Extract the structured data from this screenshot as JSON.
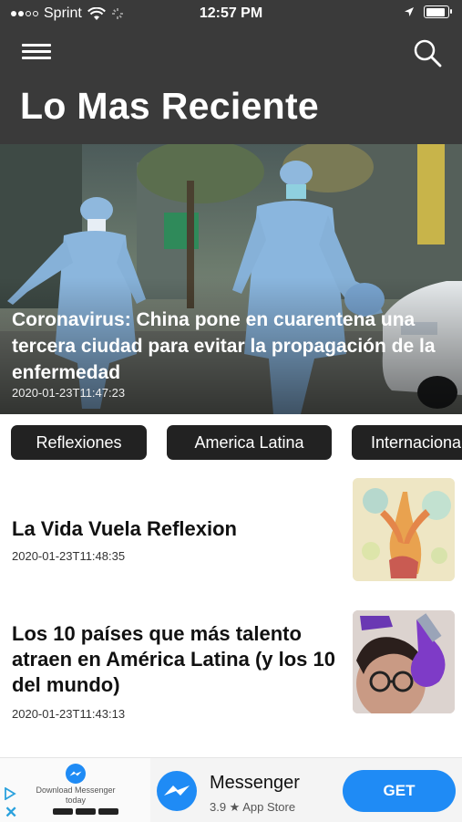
{
  "status_bar": {
    "carrier": "Sprint",
    "time": "12:57 PM"
  },
  "header": {
    "title": "Lo Mas Reciente"
  },
  "hero": {
    "title": "Coronavirus: China pone en cuarentena una tercera ciudad para evitar la propagación de la enfermedad",
    "date": "2020-01-23T11:47:23"
  },
  "categories": [
    "Reflexiones",
    "America Latina",
    "Internacional"
  ],
  "articles": [
    {
      "title": "La Vida Vuela Reflexion",
      "date": "2020-01-23T11:48:35"
    },
    {
      "title": "Los 10 países que más talento atraen en América Latina (y los 10 del mundo)",
      "date": "2020-01-23T11:43:13"
    }
  ],
  "ad": {
    "promo_text": "Download Messenger today",
    "app_name": "Messenger",
    "rating_text": "3.9 ★ App Store",
    "cta": "GET",
    "close": "✕"
  },
  "colors": {
    "header_bg": "#3a3a3a",
    "chip_bg": "#222222",
    "cta_blue": "#1f8bf5"
  }
}
